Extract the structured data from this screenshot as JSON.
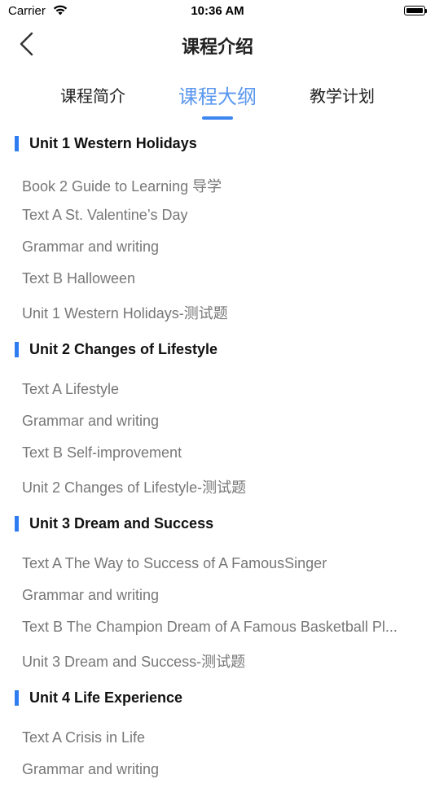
{
  "status_bar": {
    "carrier": "Carrier",
    "time": "10:36 AM"
  },
  "nav": {
    "title": "课程介绍",
    "back_icon": "chevron-left-icon"
  },
  "tabs": [
    {
      "label": "课程简介",
      "active": false
    },
    {
      "label": "课程大纲",
      "active": true
    },
    {
      "label": "教学计划",
      "active": false
    }
  ],
  "colors": {
    "accent": "#3d86f0",
    "active_tab_text": "#5a97ee",
    "lesson_text": "#777777"
  },
  "units": [
    {
      "title": "Unit 1  Western Holidays",
      "lessons": [
        "Book 2 Guide to Learning 导学",
        "Text A St. Valentine’s Day",
        "Grammar and writing",
        "Text B Halloween",
        "Unit 1  Western Holidays-测试题"
      ]
    },
    {
      "title": "Unit 2 Changes of Lifestyle",
      "lessons": [
        "Text A Lifestyle",
        "Grammar and writing",
        "Text B Self-improvement",
        "Unit 2 Changes of Lifestyle-测试题"
      ]
    },
    {
      "title": "Unit 3 Dream and Success",
      "lessons": [
        "Text A  The Way to Success of A FamousSinger",
        "Grammar and writing",
        "Text B  The Champion Dream of A Famous Basketball Pl...",
        "Unit 3 Dream and Success-测试题"
      ]
    },
    {
      "title": "Unit 4 Life Experience",
      "lessons": [
        "Text A Crisis in Life",
        "Grammar and writing"
      ]
    }
  ]
}
